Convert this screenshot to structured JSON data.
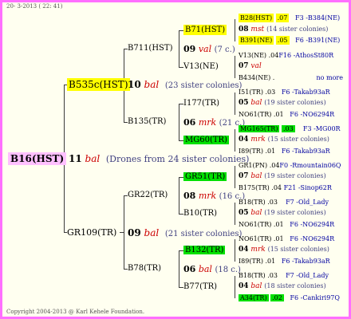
{
  "header": "20- 3-2013 ( 22: 41)",
  "copyright": "Copyright 2004-2013 @ Karl Kehele Foundation.",
  "root": {
    "name": "B16(HST)",
    "gen": "11",
    "mark": "bal",
    "note": "(Drones from 24 sister colonies)"
  },
  "g1_top": {
    "name": "B535c(HST)",
    "gen": "10",
    "mark": "bal",
    "note": "(23 sister colonies)"
  },
  "g1_bot": {
    "name": "GR109(TR)",
    "gen": "09",
    "mark": "bal",
    "note": "(21 sister colonies)"
  },
  "g2": [
    {
      "name": "B711(HST)",
      "gen": "09",
      "mark": "val",
      "note": "(7 c.)"
    },
    {
      "name": "B135(TR)",
      "gen": "06",
      "mark": "mrk",
      "note": "(21 c.)"
    },
    {
      "name": "GR22(TR)",
      "gen": "08",
      "mark": "mrk",
      "note": "(16 c.)"
    },
    {
      "name": "B78(TR)",
      "gen": "06",
      "mark": "bal",
      "note": "(18 c.)"
    }
  ],
  "g3": [
    {
      "name": "B71(HST)",
      "gen": "08",
      "mark": "mst",
      "note": "(14 sister colonies)"
    },
    {
      "name": "V13(NE)",
      "gen": "07",
      "mark": "val",
      "note": ""
    },
    {
      "name": "I177(TR)",
      "gen": "05",
      "mark": "bal",
      "note": "(19 sister colonies)"
    },
    {
      "name": "MG60(TR)",
      "gen": "04",
      "mark": "mrk",
      "note": "(15 sister colonies)"
    },
    {
      "name": "GR51(TR)",
      "gen": "07",
      "mark": "bal",
      "note": "(19 sister colonies)"
    },
    {
      "name": "B10(TR)",
      "gen": "05",
      "mark": "bal",
      "note": "(19 sister colonies)"
    },
    {
      "name": "B132(TR)",
      "gen": "04",
      "mark": "mrk",
      "note": "(15 sister colonies)"
    },
    {
      "name": "B77(TR)",
      "gen": "04",
      "mark": "bal",
      "note": "(18 sister colonies)"
    }
  ],
  "g4": [
    {
      "name": "B28(HST)",
      "num": ".07",
      "ped": "F3 -B384(NE)"
    },
    {
      "name": "B391(NE)",
      "num": ".05",
      "ped": "F6 -B391(NE)"
    },
    {
      "name": "V13(NE)",
      "num": ".04",
      "ped": "F16 -AthosSt80R"
    },
    {
      "name": "B434(NE)",
      "num": ".",
      "ped": "no more"
    },
    {
      "name": "I51(TR)",
      "num": ".03",
      "ped": "F6 -Takab93aR"
    },
    {
      "name": "NO61(TR)",
      "num": ".01",
      "ped": "F6 -NO6294R"
    },
    {
      "name": "MG165(TR)",
      "num": ".03",
      "ped": "F3 -MG00R"
    },
    {
      "name": "I89(TR)",
      "num": ".01",
      "ped": "F6 -Takab93aR"
    },
    {
      "name": "GR1(PN)",
      "num": ".04",
      "ped": "F0 -Rmountain06Q"
    },
    {
      "name": "B175(TR)",
      "num": ".04",
      "ped": "F21 -Sinop62R"
    },
    {
      "name": "B18(TR)",
      "num": ".03",
      "ped": "F7 -Old_Lady"
    },
    {
      "name": "NO61(TR)",
      "num": ".01",
      "ped": "F6 -NO6294R"
    },
    {
      "name": "NO61(TR)",
      "num": ".01",
      "ped": "F6 -NO6294R"
    },
    {
      "name": "I89(TR)",
      "num": ".01",
      "ped": "F6 -Takab93aR"
    },
    {
      "name": "B18(TR)",
      "num": ".03",
      "ped": "F7 -Old_Lady"
    },
    {
      "name": "A34(TR)",
      "num": ".02",
      "ped": "F6 -Cankiri97Q"
    }
  ]
}
